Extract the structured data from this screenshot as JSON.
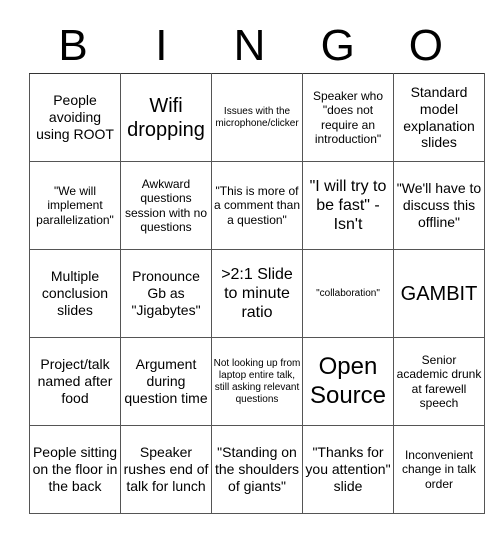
{
  "header": {
    "letters": [
      "B",
      "I",
      "N",
      "G",
      "O"
    ]
  },
  "cells": [
    [
      "People avoiding using ROOT",
      "Wifi dropping",
      "Issues with the microphone/clicker",
      "Speaker who \"does not require an introduction\"",
      "Standard model explanation slides"
    ],
    [
      "\"We will implement parallelization\"",
      "Awkward questions session with no questions",
      "\"This is more of a comment than a question\"",
      "\"I will try to be fast\" - Isn't",
      "\"We'll have to discuss this offline\""
    ],
    [
      "Multiple conclusion slides",
      "Pronounce Gb as \"Jigabytes\"",
      ">2:1 Slide to minute ratio",
      "\"collaboration\"",
      "GAMBIT"
    ],
    [
      "Project/talk named after food",
      "Argument during question time",
      "Not looking up from laptop entire talk, still asking relevant questions",
      "Open Source",
      "Senior academic drunk at farewell speech"
    ],
    [
      "People sitting on the floor in the back",
      "Speaker rushes end of talk for lunch",
      "\"Standing on the shoulders of giants\"",
      "\"Thanks for you attention\" slide",
      "Inconvenient change in talk order"
    ]
  ]
}
